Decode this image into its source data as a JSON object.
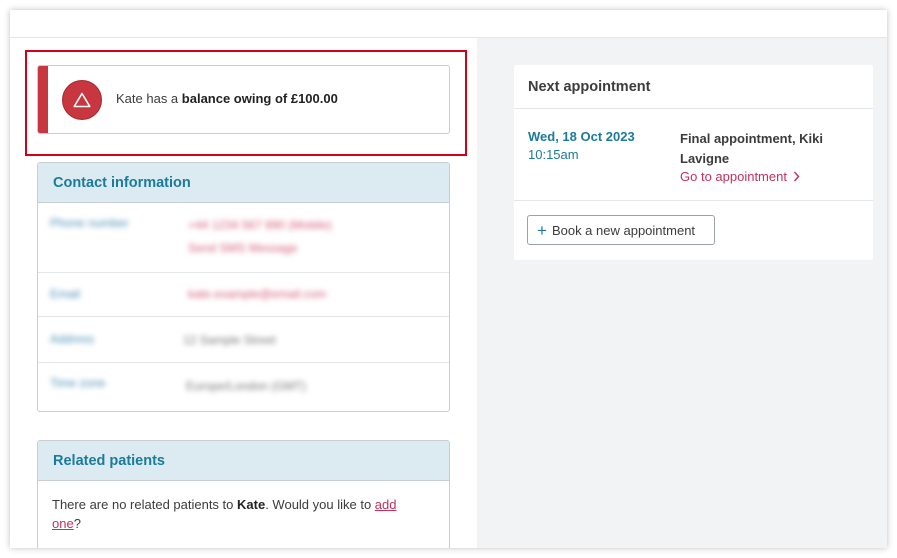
{
  "alert": {
    "prefix": "Kate has a ",
    "emphasis": "balance owing of £100.00",
    "color": "#c8373f"
  },
  "contact": {
    "title": "Contact information",
    "rows": [
      {
        "label": "Phone number",
        "value": "+44 1234 567 890 (Mobile)",
        "value2": "Send SMS Message"
      },
      {
        "label": "Email",
        "value": "kate.example@email.com"
      },
      {
        "label": "Address",
        "value": "12 Sample Street"
      },
      {
        "label": "Time zone",
        "value": "Europe/London (GMT)"
      }
    ]
  },
  "related": {
    "title": "Related patients",
    "text_prefix": "There are no related patients to ",
    "name": "Kate",
    "text_mid": ". Would you like to ",
    "link_word1": "add",
    "link_word2": "one",
    "text_suffix": "?"
  },
  "appointment": {
    "title": "Next appointment",
    "date": "Wed, 18 Oct 2023",
    "time": "10:15am",
    "name_line1": "Final appointment, Kiki",
    "name_line2": "Lavigne",
    "link": "Go to appointment",
    "book_button": "Book a new appointment"
  },
  "colors": {
    "accent": "#1b7b9a",
    "link": "#c2315c",
    "highlight": "#d0021b"
  }
}
